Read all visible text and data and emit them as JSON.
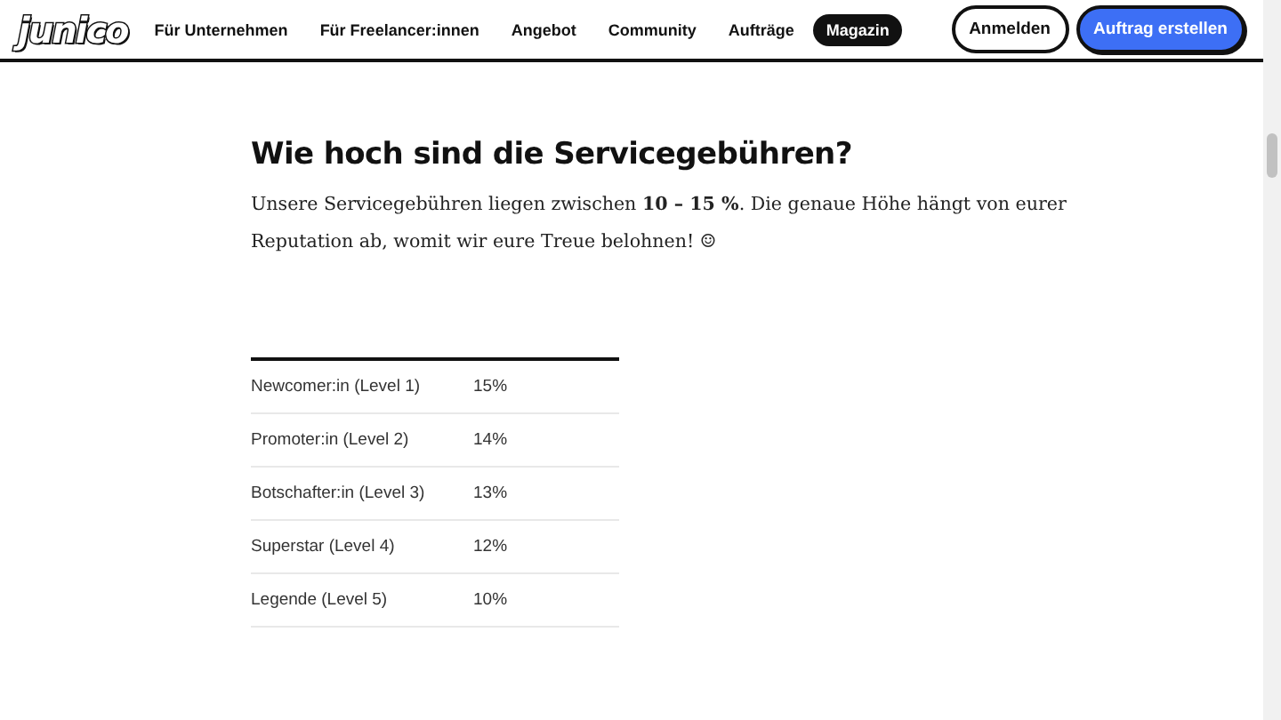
{
  "header": {
    "logo": "junico",
    "nav": [
      {
        "label": "Für Unternehmen",
        "selected": false
      },
      {
        "label": "Für Freelancer:innen",
        "selected": false
      },
      {
        "label": "Angebot",
        "selected": false
      },
      {
        "label": "Community",
        "selected": false
      },
      {
        "label": "Aufträge",
        "selected": false
      },
      {
        "label": "Magazin",
        "selected": true
      }
    ],
    "buttons": [
      {
        "label": "Anmelden",
        "kind": "outline"
      },
      {
        "label": "Auftrag erstellen",
        "kind": "primary"
      }
    ]
  },
  "article": {
    "heading": "Wie hoch sind die Servicegebühren?",
    "paragraph": "Unsere Servicegebühren liegen zwischen **10 – 15 %**. Die genaue Höhe hängt von eurer Reputation ab, womit wir eure Treue belohnen! ☺",
    "table": {
      "rows": [
        {
          "level": "Newcomer:in (Level 1)",
          "fee": "15%"
        },
        {
          "level": "Promoter:in (Level 2)",
          "fee": "14%"
        },
        {
          "level": "Botschafter:in (Level 3)",
          "fee": "13%"
        },
        {
          "level": "Superstar (Level 4)",
          "fee": "12%"
        },
        {
          "level": "Legende (Level 5)",
          "fee": "10%"
        }
      ]
    }
  }
}
